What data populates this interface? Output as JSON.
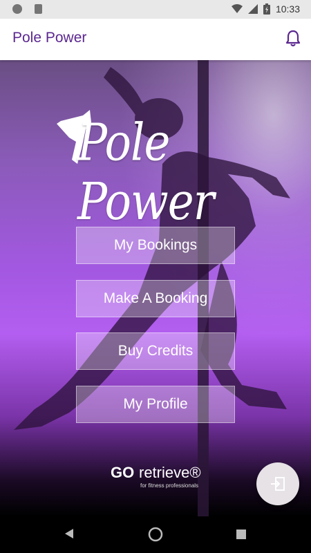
{
  "status_bar": {
    "time": "10:33",
    "icons": [
      "notification-dot-icon",
      "sd-card-icon",
      "wifi-icon",
      "signal-icon",
      "battery-charging-icon"
    ]
  },
  "app_bar": {
    "title": "Pole Power",
    "action_icon": "bell-icon"
  },
  "hero": {
    "logo_text": "Pole Power",
    "menu": [
      {
        "id": "my-bookings",
        "label": "My Bookings"
      },
      {
        "id": "make-a-booking",
        "label": "Make A Booking"
      },
      {
        "id": "buy-credits",
        "label": "Buy Credits"
      },
      {
        "id": "my-profile",
        "label": "My Profile"
      }
    ]
  },
  "footer_brand": {
    "mark": "GO",
    "name": "retrieve®",
    "tagline": "for fitness professionals"
  },
  "fab": {
    "icon": "logout-icon"
  },
  "nav_bar": {
    "icons": [
      "back-icon",
      "home-icon",
      "recents-icon"
    ]
  },
  "colors": {
    "accent": "#5b2790",
    "hero_purple": "#a258e0"
  }
}
